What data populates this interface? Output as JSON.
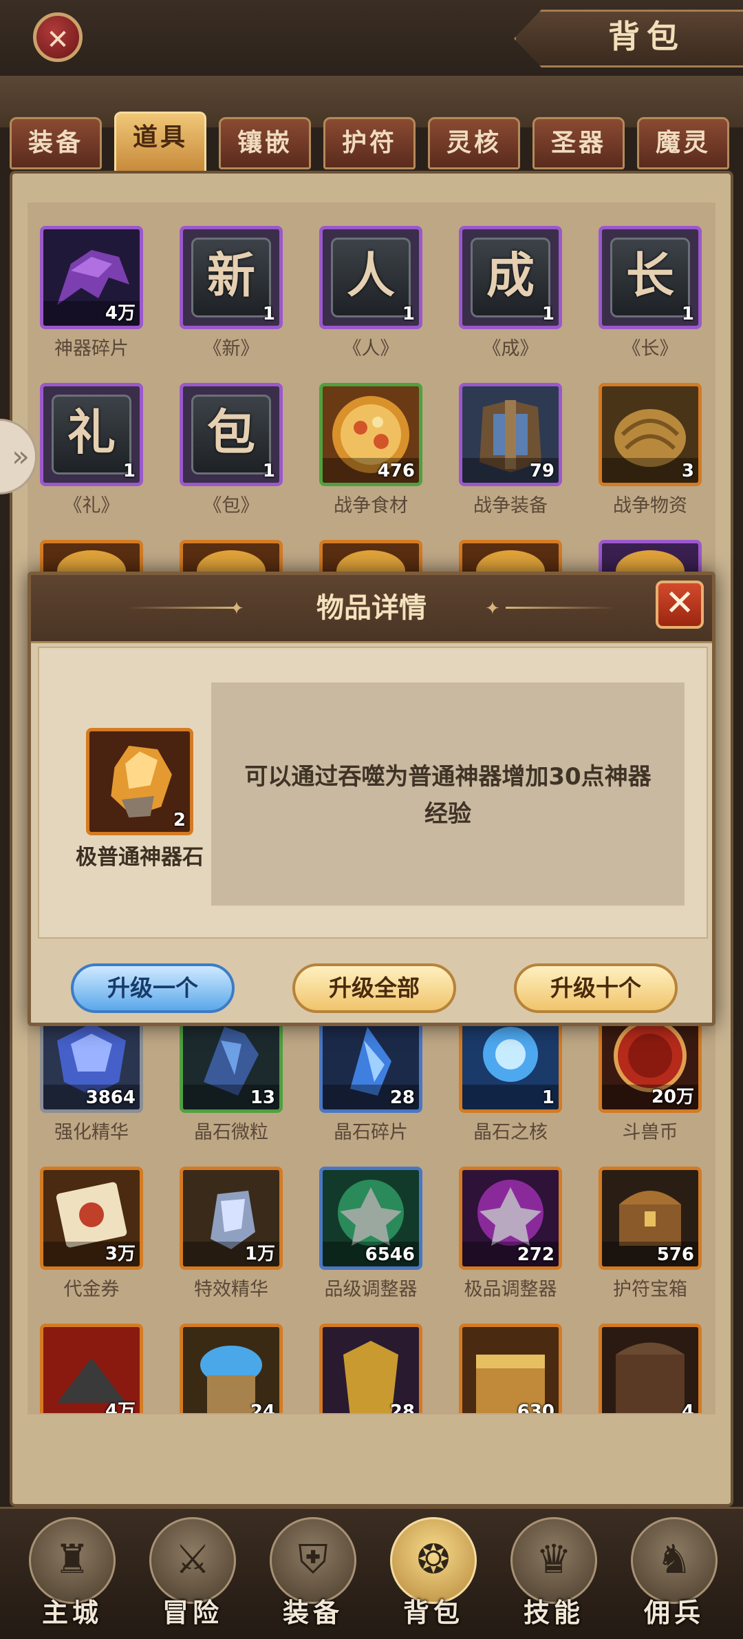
{
  "header": {
    "title": "背包",
    "close_icon": "close-icon"
  },
  "tabs": [
    {
      "label": "装备",
      "active": false
    },
    {
      "label": "道具",
      "active": true
    },
    {
      "label": "镶嵌",
      "active": false
    },
    {
      "label": "护符",
      "active": false
    },
    {
      "label": "灵核",
      "active": false
    },
    {
      "label": "圣器",
      "active": false
    },
    {
      "label": "魔灵",
      "active": false
    }
  ],
  "grid": {
    "row1": [
      {
        "name": "神器碎片",
        "count": "4万",
        "rarity": "purple",
        "icon": "artifact-shard-icon"
      },
      {
        "name": "《新》",
        "count": "1",
        "rarity": "purple",
        "glyph": "新"
      },
      {
        "name": "《人》",
        "count": "1",
        "rarity": "purple",
        "glyph": "人"
      },
      {
        "name": "《成》",
        "count": "1",
        "rarity": "purple",
        "glyph": "成"
      },
      {
        "name": "《长》",
        "count": "1",
        "rarity": "purple",
        "glyph": "长"
      }
    ],
    "row2": [
      {
        "name": "《礼》",
        "count": "1",
        "rarity": "purple",
        "glyph": "礼"
      },
      {
        "name": "《包》",
        "count": "1",
        "rarity": "purple",
        "glyph": "包"
      },
      {
        "name": "战争食材",
        "count": "476",
        "rarity": "green",
        "icon": "war-food-icon"
      },
      {
        "name": "战争装备",
        "count": "79",
        "rarity": "purple",
        "icon": "war-gear-icon"
      },
      {
        "name": "战争物资",
        "count": "3",
        "rarity": "orange",
        "icon": "war-supplies-icon"
      }
    ],
    "row4": [
      {
        "name": "强化精华",
        "count": "3864",
        "rarity": "gray",
        "icon": "enhance-essence-icon"
      },
      {
        "name": "晶石微粒",
        "count": "13",
        "rarity": "green",
        "icon": "crystal-particle-icon"
      },
      {
        "name": "晶石碎片",
        "count": "28",
        "rarity": "blue",
        "icon": "crystal-shard-icon"
      },
      {
        "name": "晶石之核",
        "count": "1",
        "rarity": "orange",
        "icon": "crystal-core-icon"
      },
      {
        "name": "斗兽币",
        "count": "20万",
        "rarity": "orange",
        "icon": "beast-coin-icon"
      }
    ],
    "row5": [
      {
        "name": "代金券",
        "count": "3万",
        "rarity": "orange",
        "icon": "voucher-icon"
      },
      {
        "name": "特效精华",
        "count": "1万",
        "rarity": "orange",
        "icon": "effect-essence-icon"
      },
      {
        "name": "品级调整器",
        "count": "6546",
        "rarity": "blue",
        "icon": "grade-adjuster-icon"
      },
      {
        "name": "极品调整器",
        "count": "272",
        "rarity": "orange",
        "icon": "premium-adjuster-icon"
      },
      {
        "name": "护符宝箱",
        "count": "576",
        "rarity": "orange",
        "icon": "amulet-chest-icon"
      }
    ],
    "row6": [
      {
        "name": "",
        "count": "4万",
        "rarity": "orange",
        "icon": "ore-pile-icon"
      },
      {
        "name": "",
        "count": "24",
        "rarity": "orange",
        "icon": "gem-bag-icon"
      },
      {
        "name": "",
        "count": "28",
        "rarity": "orange",
        "icon": "gold-armor-icon"
      },
      {
        "name": "",
        "count": "630",
        "rarity": "orange",
        "icon": "treasure-chest-icon"
      },
      {
        "name": "",
        "count": "4",
        "rarity": "orange",
        "icon": "iron-chest-icon"
      }
    ]
  },
  "dialog": {
    "title": "物品详情",
    "item_name": "极普通神器石",
    "item_count": "2",
    "description": "可以通过吞噬为普通神器增加30点神器经验",
    "buttons": {
      "upgrade_one": "升级一个",
      "upgrade_all": "升级全部",
      "upgrade_ten": "升级十个"
    }
  },
  "bottom_nav": [
    {
      "label": "主城",
      "icon": "castle-icon",
      "active": false
    },
    {
      "label": "冒险",
      "icon": "crossed-swords-icon",
      "active": false
    },
    {
      "label": "装备",
      "icon": "helmet-icon",
      "active": false
    },
    {
      "label": "背包",
      "icon": "backpack-icon",
      "active": true
    },
    {
      "label": "技能",
      "icon": "skill-card-icon",
      "active": false
    },
    {
      "label": "佣兵",
      "icon": "knight-icon",
      "active": false
    }
  ]
}
